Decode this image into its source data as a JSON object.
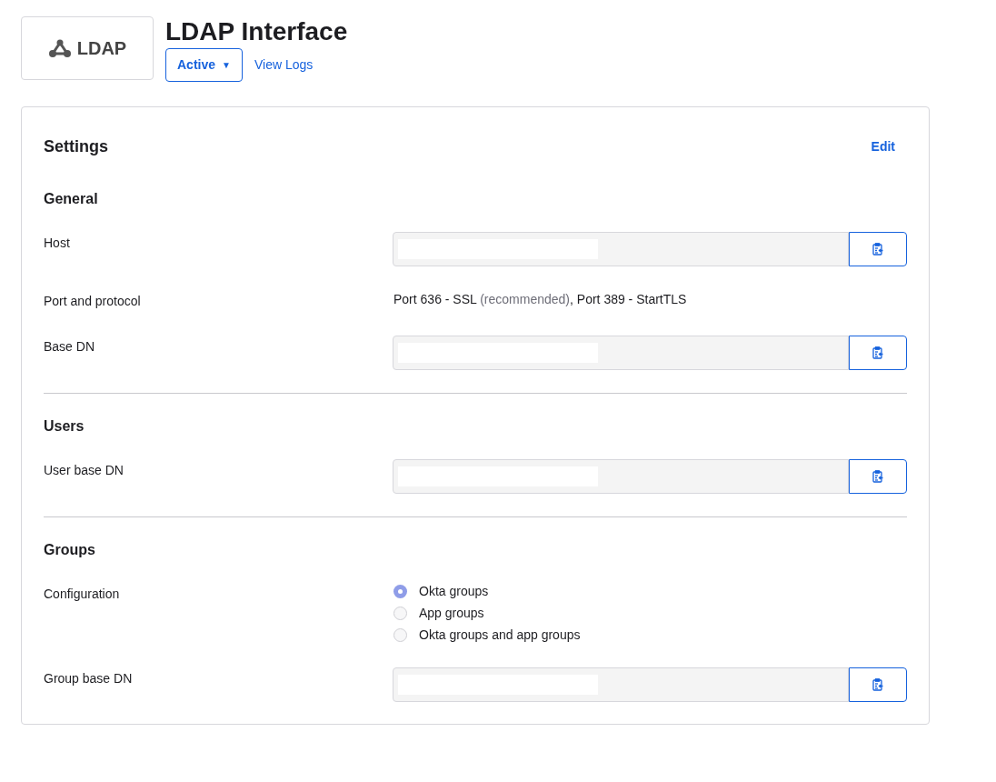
{
  "logo": {
    "text": "LDAP"
  },
  "header": {
    "title": "LDAP Interface",
    "status_button": "Active",
    "status_caret": "▼",
    "link": "View Logs"
  },
  "settings": {
    "title": "Settings",
    "edit_link": "Edit",
    "sections": [
      {
        "title": "General",
        "rows": [
          {
            "kind": "field",
            "label": "Host"
          },
          {
            "kind": "text",
            "label": "Port and protocol",
            "parts": [
              {
                "text": "Port 636 - SSL",
                "muted": false
              },
              {
                "text": "(recommended)",
                "muted": true
              },
              {
                "text": ", Port 389 - StartTLS",
                "muted": false
              }
            ]
          },
          {
            "kind": "field",
            "label": "Base DN"
          }
        ]
      },
      {
        "title": "Users",
        "rows": [
          {
            "kind": "field",
            "label": "User base DN"
          }
        ]
      },
      {
        "title": "Groups",
        "rows": [
          {
            "kind": "radio",
            "label": "Configuration",
            "options": [
              {
                "label": "Okta groups",
                "selected": true
              },
              {
                "label": "App groups",
                "selected": false
              },
              {
                "label": "Okta groups and app groups",
                "selected": false
              }
            ]
          },
          {
            "kind": "field",
            "label": "Group base DN"
          }
        ]
      }
    ]
  }
}
